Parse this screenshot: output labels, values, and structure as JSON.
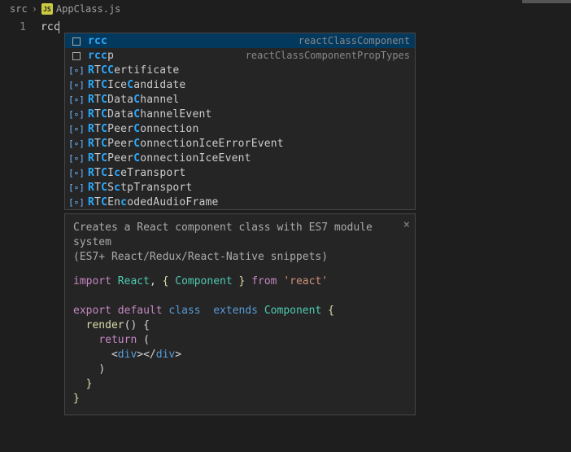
{
  "breadcrumb": {
    "folder": "src",
    "file": "AppClass.js",
    "file_icon_text": "JS"
  },
  "editor": {
    "line_number": "1",
    "typed_text": "rcc"
  },
  "suggestions": {
    "items": [
      {
        "type": "snippet",
        "pre": "",
        "hl": "rcc",
        "post": "",
        "detail": "reactClassComponent"
      },
      {
        "type": "snippet",
        "pre": "",
        "hl": "rcc",
        "post": "p",
        "detail": "reactClassComponentPropTypes"
      },
      {
        "type": "var",
        "pre": "",
        "hl1": "R",
        "mid1": "T",
        "hl2": "CC",
        "post": "ertificate"
      },
      {
        "type": "var",
        "pre": "",
        "hl1": "R",
        "mid1": "T",
        "hl2": "C",
        "mid2": "Ice",
        "hl3": "C",
        "post": "andidate"
      },
      {
        "type": "var",
        "pre": "",
        "hl1": "R",
        "mid1": "T",
        "hl2": "C",
        "mid2": "Data",
        "hl3": "C",
        "post": "hannel"
      },
      {
        "type": "var",
        "pre": "",
        "hl1": "R",
        "mid1": "T",
        "hl2": "C",
        "mid2": "Data",
        "hl3": "C",
        "post": "hannelEvent"
      },
      {
        "type": "var",
        "pre": "",
        "hl1": "R",
        "mid1": "T",
        "hl2": "C",
        "mid2": "Peer",
        "hl3": "C",
        "post": "onnection"
      },
      {
        "type": "var",
        "pre": "",
        "hl1": "R",
        "mid1": "T",
        "hl2": "C",
        "mid2": "Peer",
        "hl3": "C",
        "post": "onnectionIceErrorEvent"
      },
      {
        "type": "var",
        "pre": "",
        "hl1": "R",
        "mid1": "T",
        "hl2": "C",
        "mid2": "Peer",
        "hl3": "C",
        "post": "onnectionIceEvent"
      },
      {
        "type": "var",
        "pre": "",
        "hl1": "R",
        "mid1": "T",
        "hl2": "C",
        "mid2": "I",
        "hl3": "c",
        "post": "eTransport"
      },
      {
        "type": "var",
        "pre": "",
        "hl1": "R",
        "mid1": "T",
        "hl2": "C",
        "mid2": "S",
        "hl3": "c",
        "post": "tpTransport"
      },
      {
        "type": "var",
        "pre": "",
        "hl1": "R",
        "mid1": "T",
        "hl2": "C",
        "mid2": "En",
        "hl3": "c",
        "post": "odedAudioFrame"
      }
    ]
  },
  "detail": {
    "desc_line1": "Creates a React component class with ES7 module system",
    "desc_line2": "(ES7+ React/Redux/React-Native snippets)",
    "close": "×",
    "code": {
      "l1": {
        "w1": "import",
        "w2": "React",
        "w3": ",",
        "w4": "{",
        "w5": "Component",
        "w6": "}",
        "w7": "from",
        "w8": "'react'"
      },
      "l3": {
        "w1": "export",
        "w2": "default",
        "w3": "class",
        "w4": "",
        "w5": "extends",
        "w6": "Component",
        "w7": "{"
      },
      "l4": {
        "indent": "  ",
        "w1": "render",
        "w2": "() {"
      },
      "l5": {
        "indent": "    ",
        "w1": "return",
        "w2": " ("
      },
      "l6": {
        "indent": "      ",
        "w1": "<",
        "w2": "div",
        "w3": "></",
        "w4": "div",
        "w5": ">"
      },
      "l7": {
        "indent": "    ",
        "w1": ")"
      },
      "l8": {
        "indent": "  ",
        "w1": "}"
      },
      "l9": {
        "w1": "}"
      }
    }
  }
}
